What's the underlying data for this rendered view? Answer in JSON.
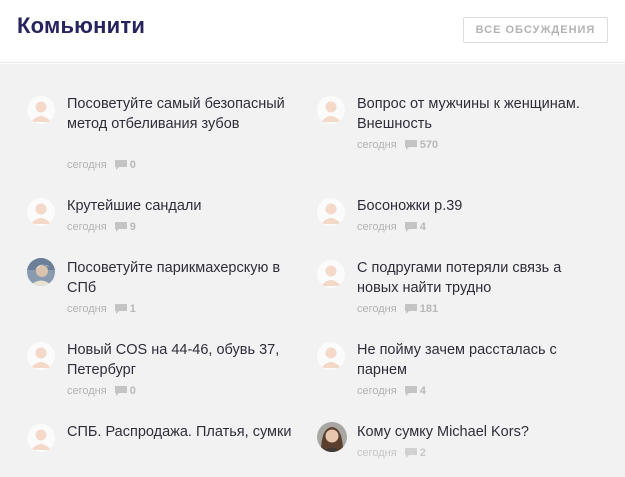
{
  "header": {
    "title": "Комьюнити",
    "all_discussions_label": "ВСЕ ОБСУЖДЕНИЯ"
  },
  "colors": {
    "title": "#26245f",
    "text": "#2e2e3a",
    "muted": "#b3b3b3",
    "background": "#f2f2f2",
    "avatar_placeholder": "#f4d8c8"
  },
  "discussions": [
    {
      "title": "Посоветуйте самый безопасный метод отбеливания зубов",
      "date": "сегодня",
      "comments": "0",
      "avatar": "placeholder-avatar-icon"
    },
    {
      "title": "Вопрос от мужчины к женщинам. Внешность",
      "date": "сегодня",
      "comments": "570",
      "avatar": "placeholder-avatar-icon"
    },
    {
      "title": "Крутейшие сандали",
      "date": "сегодня",
      "comments": "9",
      "avatar": "placeholder-avatar-icon"
    },
    {
      "title": "Босоножки р.39",
      "date": "сегодня",
      "comments": "4",
      "avatar": "placeholder-avatar-icon"
    },
    {
      "title": "Посоветуйте парикмахерскую в СПб",
      "date": "сегодня",
      "comments": "1",
      "avatar": "user-photo-avatar"
    },
    {
      "title": "С подругами потеряли связь а новых найти трудно",
      "date": "сегодня",
      "comments": "181",
      "avatar": "placeholder-avatar-icon"
    },
    {
      "title": "Новый COS на 44-46, обувь 37, Петербург",
      "date": "сегодня",
      "comments": "0",
      "avatar": "placeholder-avatar-icon"
    },
    {
      "title": "Не пойму зачем рассталась с парнем",
      "date": "сегодня",
      "comments": "4",
      "avatar": "placeholder-avatar-icon"
    },
    {
      "title": "СПБ. Распродажа. Платья, сумки",
      "date": "",
      "comments": "",
      "avatar": "placeholder-avatar-icon"
    },
    {
      "title": "Кому сумку Michael Kors?",
      "date": "сегодня",
      "comments": "2",
      "avatar": "user-photo-avatar"
    }
  ]
}
